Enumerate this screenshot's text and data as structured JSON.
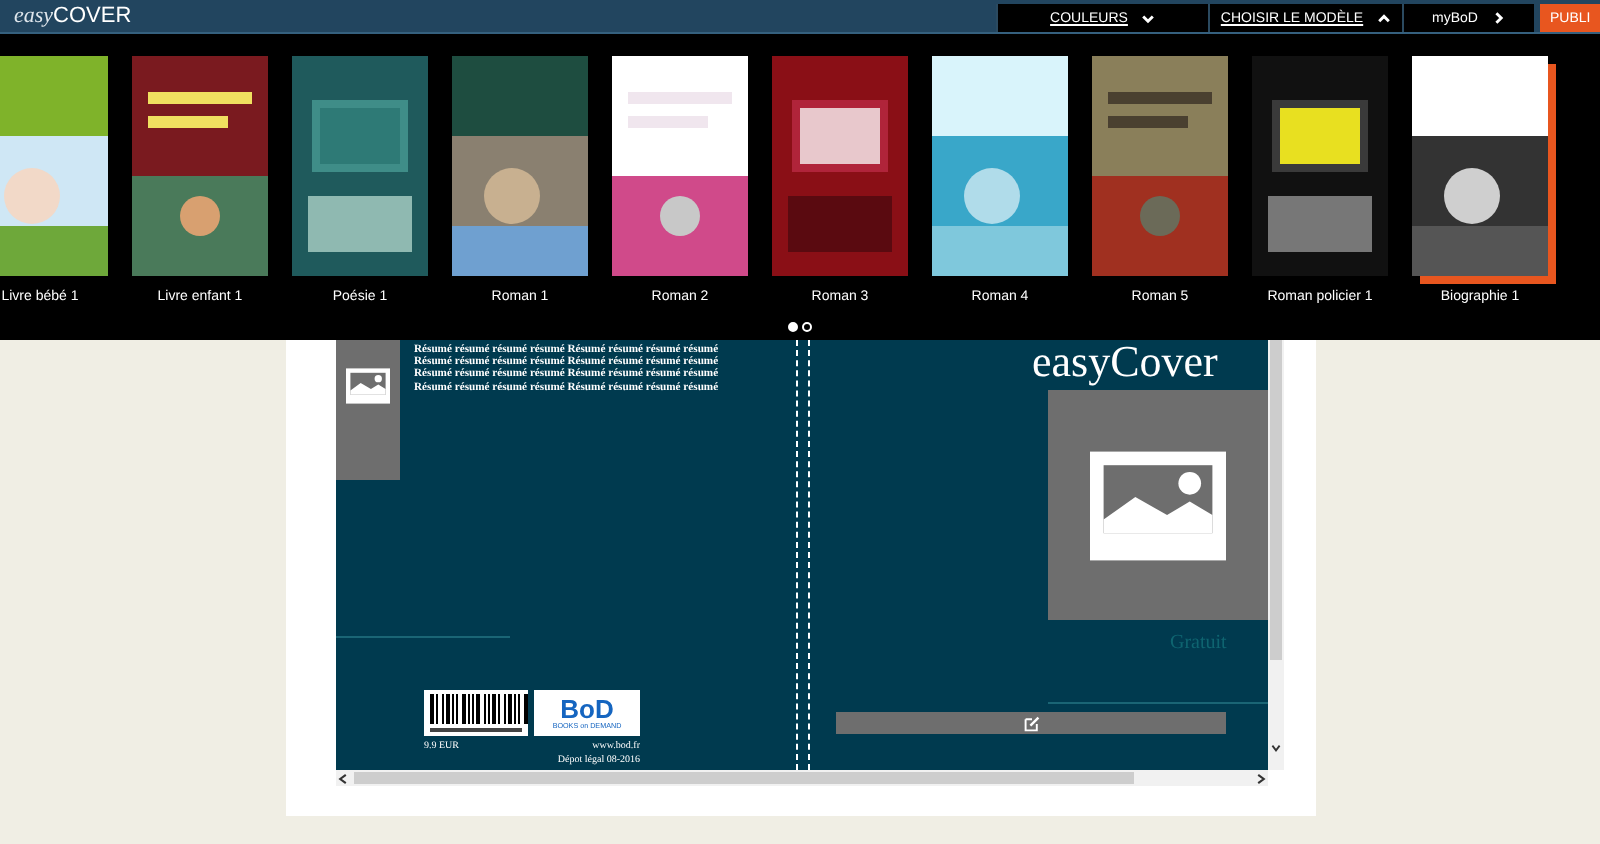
{
  "header": {
    "logo_prefix": "easy",
    "logo_main": "COVER"
  },
  "nav": [
    {
      "label": "COULEURS",
      "kind": "dropdown",
      "expanded": false
    },
    {
      "label": "CHOISIR LE MODÈLE",
      "kind": "dropdown",
      "expanded": true
    },
    {
      "label": "myBoD",
      "kind": "link"
    },
    {
      "label": "PUBLI",
      "kind": "primary"
    }
  ],
  "templates": [
    {
      "label": "Livre bébé 1",
      "selected": false
    },
    {
      "label": "Livre enfant 1",
      "selected": false
    },
    {
      "label": "Poésie 1",
      "selected": false
    },
    {
      "label": "Roman 1",
      "selected": false
    },
    {
      "label": "Roman 2",
      "selected": false
    },
    {
      "label": "Roman 3",
      "selected": false
    },
    {
      "label": "Roman 4",
      "selected": false
    },
    {
      "label": "Roman 5",
      "selected": false
    },
    {
      "label": "Roman policier 1",
      "selected": false
    },
    {
      "label": "Biographie 1",
      "selected": true
    }
  ],
  "pager": [
    {
      "selected": true
    },
    {
      "selected": false
    }
  ],
  "cover": {
    "back": {
      "summary": [
        "Résumé résumé résumé résumé Résumé résumé résumé résumé",
        "Résumé résumé résumé résumé Résumé résumé résumé résumé",
        "Résumé résumé résumé résumé Résumé résumé résumé résumé",
        "Résumé résumé résumé résumé Résumé résumé résumé résumé"
      ],
      "publisher_logo": "BoD",
      "publisher_tagline": "BOOKS on DEMAND",
      "price": "9.9 EUR",
      "website": "www.bod.fr",
      "legal": "Dépot légal 08-2016"
    },
    "front": {
      "title": "easyCover",
      "price_label": "Gratuit"
    }
  }
}
